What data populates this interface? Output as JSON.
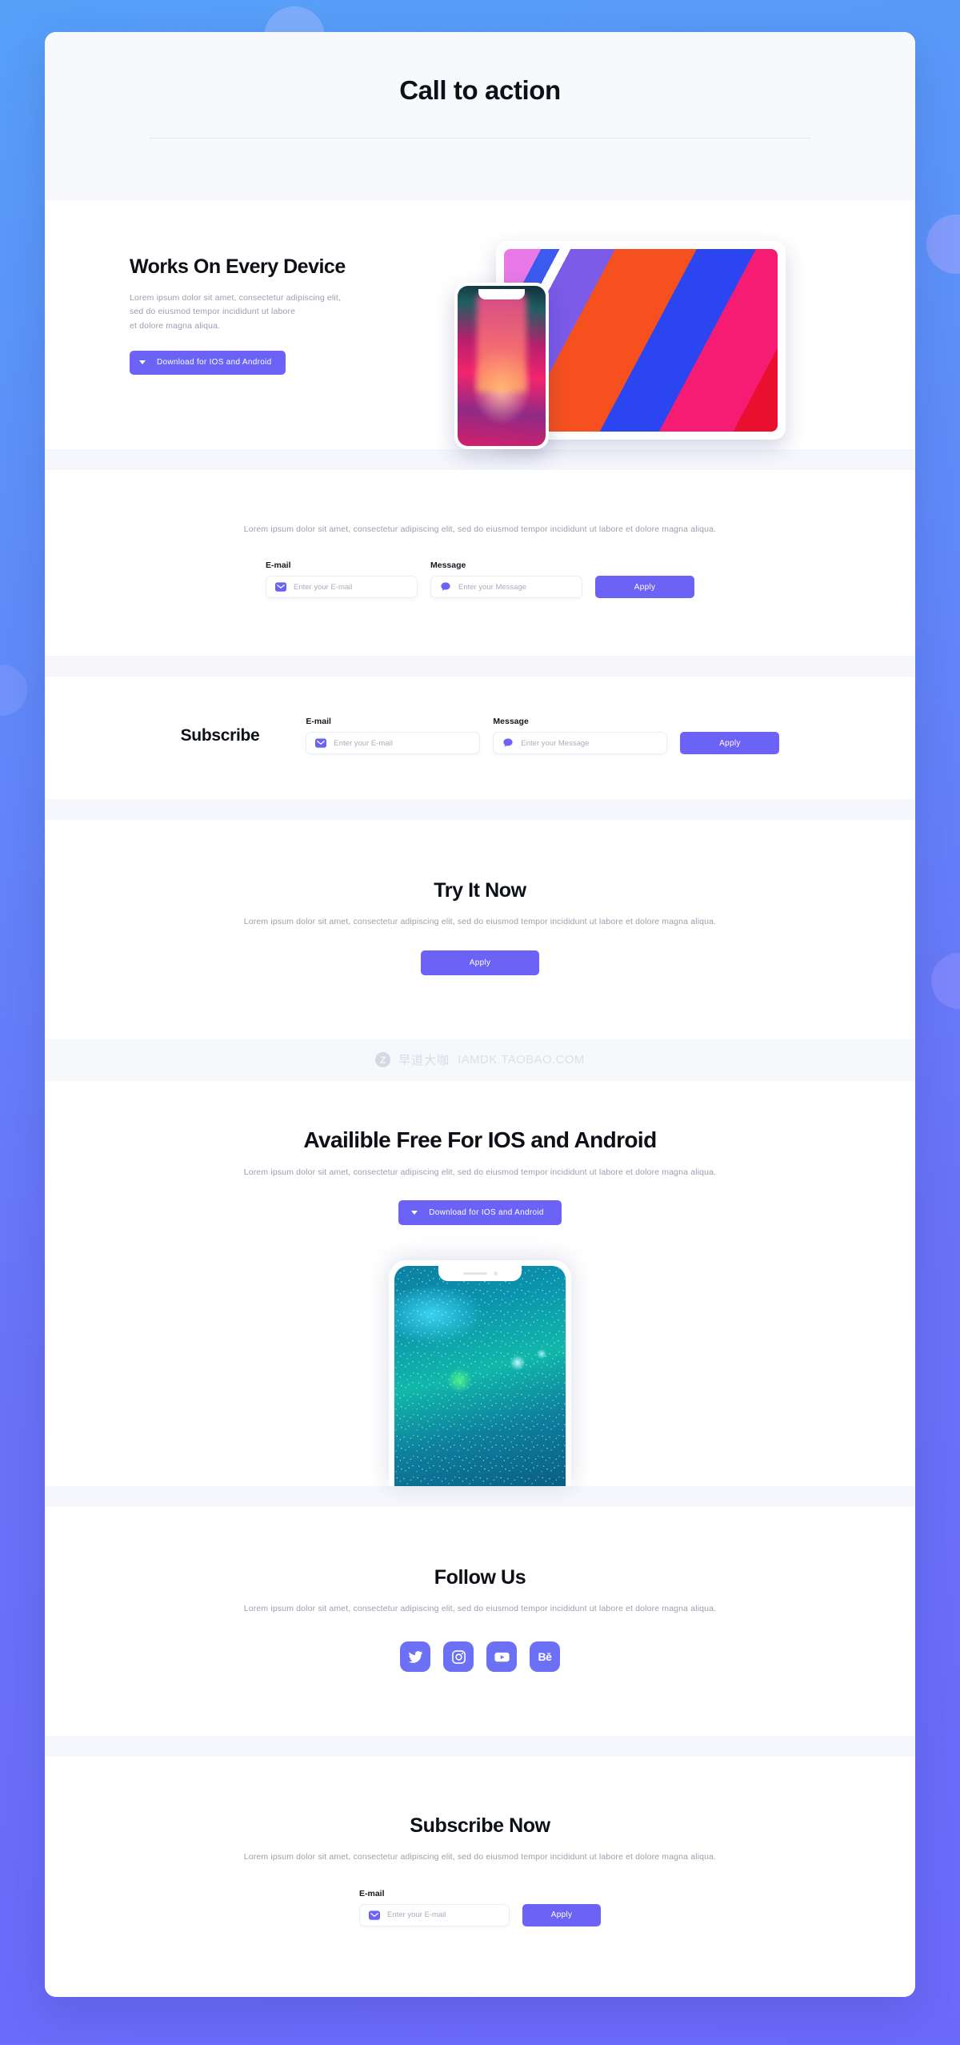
{
  "theme": {
    "accent": "#6c63f6",
    "accent_social": "#6c70f5",
    "bg_gradient_from": "#56a0f8",
    "bg_gradient_to": "#6b69fa",
    "card_bg": "#ffffff",
    "band_bg": "#f7f8fc",
    "heading_color": "#0d1117",
    "body_color": "#9a9fae"
  },
  "header": {
    "title": "Call to action"
  },
  "common": {
    "paragraph": "Lorem ipsum dolor sit amet, consectetur adipiscing elit, sed do eiusmod tempor incididunt ut labore et dolore magna aliqua.",
    "email_label": "E-mail",
    "message_label": "Message",
    "email_placeholder": "Enter your E-mail",
    "message_placeholder": "Enter your Message",
    "apply_label": "Apply",
    "download_label": "Download for IOS and Android",
    "email_icon": "envelope-icon",
    "message_icon": "chat-bubble-icon",
    "caret_icon": "chevron-down-icon"
  },
  "device_section": {
    "heading": "Works On Every Device",
    "paragraph_line1": "Lorem ipsum dolor sit amet, consectetur adipiscing elit,",
    "paragraph_line2": "sed do eiusmod tempor incididunt ut labore",
    "paragraph_line3": "et dolore magna aliqua.",
    "download_label": "Download for IOS and Android",
    "art_tablet": "tablet-mockup-diagonal-stripes",
    "art_phone": "phone-mockup-gradient-corridor"
  },
  "inline_form_section": {
    "paragraph": "Lorem ipsum dolor sit amet, consectetur adipiscing elit, sed do eiusmod tempor incididunt ut labore et dolore magna aliqua.",
    "email_label": "E-mail",
    "message_label": "Message",
    "email_placeholder": "Enter your E-mail",
    "message_placeholder": "Enter your Message",
    "apply_label": "Apply"
  },
  "subscribe_section": {
    "heading": "Subscribe",
    "email_label": "E-mail",
    "message_label": "Message",
    "email_placeholder": "Enter your E-mail",
    "message_placeholder": "Enter your Message",
    "apply_label": "Apply"
  },
  "try_section": {
    "heading": "Try It Now",
    "paragraph": "Lorem ipsum dolor sit amet, consectetur adipiscing elit, sed do eiusmod tempor incididunt ut labore et dolore magna aliqua.",
    "apply_label": "Apply"
  },
  "watermark": {
    "logo": "z-circle-logo",
    "cn_text": "早道大咖",
    "url_text": "IAMDK.TAOBAO.COM"
  },
  "availible_section": {
    "heading": "Availible Free For IOS and Android",
    "paragraph": "Lorem ipsum dolor sit amet, consectetur adipiscing elit, sed do eiusmod tempor incididunt ut labore et dolore magna aliqua.",
    "download_label": "Download for IOS and Android",
    "art_phone": "phone-mockup-concert-crowd"
  },
  "follow_section": {
    "heading": "Follow Us",
    "paragraph": "Lorem ipsum dolor sit amet, consectetur adipiscing elit, sed do eiusmod tempor incididunt ut labore et dolore magna aliqua.",
    "socials": [
      {
        "name": "twitter",
        "icon": "twitter-icon",
        "label": ""
      },
      {
        "name": "instagram",
        "icon": "instagram-icon",
        "label": ""
      },
      {
        "name": "youtube",
        "icon": "youtube-icon",
        "label": ""
      },
      {
        "name": "behance",
        "icon": "behance-icon",
        "label": "Bē"
      }
    ]
  },
  "subscribe_now_section": {
    "heading": "Subscribe Now",
    "paragraph": "Lorem ipsum dolor sit amet, consectetur adipiscing elit, sed do eiusmod tempor incididunt ut labore et dolore magna aliqua.",
    "email_label": "E-mail",
    "email_placeholder": "Enter your E-mail",
    "apply_label": "Apply"
  }
}
